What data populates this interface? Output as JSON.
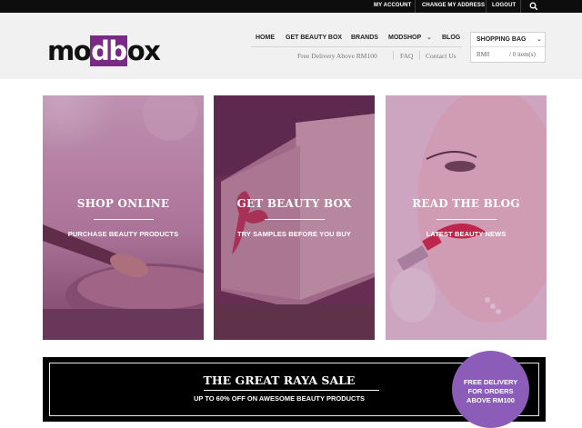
{
  "topbar": {
    "links": [
      "MY ACCOUNT",
      "CHANGE MY ADDRESS",
      "LOGOUT"
    ],
    "search_icon": "search-icon"
  },
  "logo": {
    "part1": "mo",
    "part2": "db",
    "part3": "ox",
    "accent": "#7a2a86"
  },
  "nav": {
    "items": [
      "HOME",
      "GET BEAUTY BOX",
      "BRANDS",
      "MODSHOP",
      "BLOG"
    ],
    "modshop_chevron": "chevron-down-icon"
  },
  "subnav": {
    "items": [
      "Free Delivery Above RM100",
      "FAQ",
      "Contact Us"
    ]
  },
  "bag": {
    "title": "SHOPPING BAG",
    "amount": "RM0",
    "items": "/ 0 item(s)"
  },
  "panels": [
    {
      "title": "SHOP ONLINE",
      "subtitle": "PURCHASE BEAUTY PRODUCTS"
    },
    {
      "title": "GET BEAUTY BOX",
      "subtitle": "TRY SAMPLES BEFORE YOU BUY"
    },
    {
      "title": "READ THE BLOG",
      "subtitle": "LATEST BEAUTY NEWS"
    }
  ],
  "sale": {
    "title": "THE GREAT RAYA SALE",
    "subtitle": "UP TO 60% OFF ON AWESOME BEAUTY PRODUCTS"
  },
  "badge": {
    "lines": [
      "FREE DELIVERY",
      "FOR ORDERS",
      "ABOVE RM100"
    ],
    "color": "#8b5db9"
  }
}
